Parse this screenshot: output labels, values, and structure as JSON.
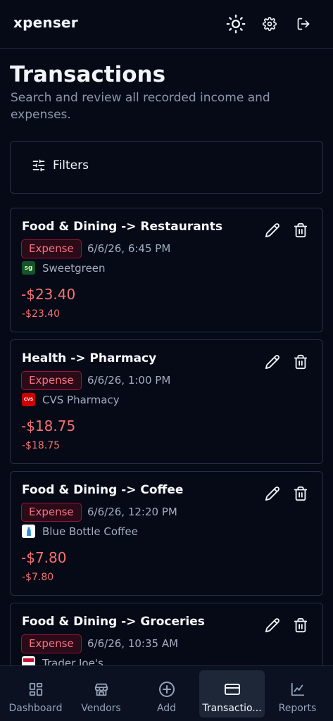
{
  "app": {
    "brand": "xpenser"
  },
  "header": {
    "theme_icon": "sun-icon",
    "settings_icon": "gear-icon",
    "logout_icon": "logout-icon"
  },
  "page": {
    "title": "Transactions",
    "subtitle": "Search and review all recorded income and expenses."
  },
  "filters": {
    "label": "Filters"
  },
  "transactions": [
    {
      "category": "Food & Dining -> Restaurants",
      "type": "Expense",
      "datetime": "6/6/26, 6:45 PM",
      "vendor": "Sweetgreen",
      "vendor_logo_text": "sg",
      "amount": "-$23.40",
      "amount_secondary": "-$23.40"
    },
    {
      "category": "Health -> Pharmacy",
      "type": "Expense",
      "datetime": "6/6/26, 1:00 PM",
      "vendor": "CVS Pharmacy",
      "vendor_logo_text": "CVS",
      "amount": "-$18.75",
      "amount_secondary": "-$18.75"
    },
    {
      "category": "Food & Dining -> Coffee",
      "type": "Expense",
      "datetime": "6/6/26, 12:20 PM",
      "vendor": "Blue Bottle Coffee",
      "vendor_logo_text": "",
      "amount": "-$7.80",
      "amount_secondary": "-$7.80"
    },
    {
      "category": "Food & Dining -> Groceries",
      "type": "Expense",
      "datetime": "6/6/26, 10:35 AM",
      "vendor": "Trader Joe's",
      "vendor_logo_text": "",
      "amount": "",
      "amount_secondary": ""
    }
  ],
  "nav": {
    "items": [
      {
        "label": "Dashboard",
        "icon": "dashboard-icon"
      },
      {
        "label": "Vendors",
        "icon": "store-icon"
      },
      {
        "label": "Add",
        "icon": "plus-circle-icon"
      },
      {
        "label": "Transactio...",
        "icon": "credit-card-icon"
      },
      {
        "label": "Reports",
        "icon": "chart-icon"
      }
    ]
  },
  "colors": {
    "background": "#050a16",
    "expense": "#f87171",
    "badge_border": "#9f1239",
    "muted": "#a3aebe"
  }
}
